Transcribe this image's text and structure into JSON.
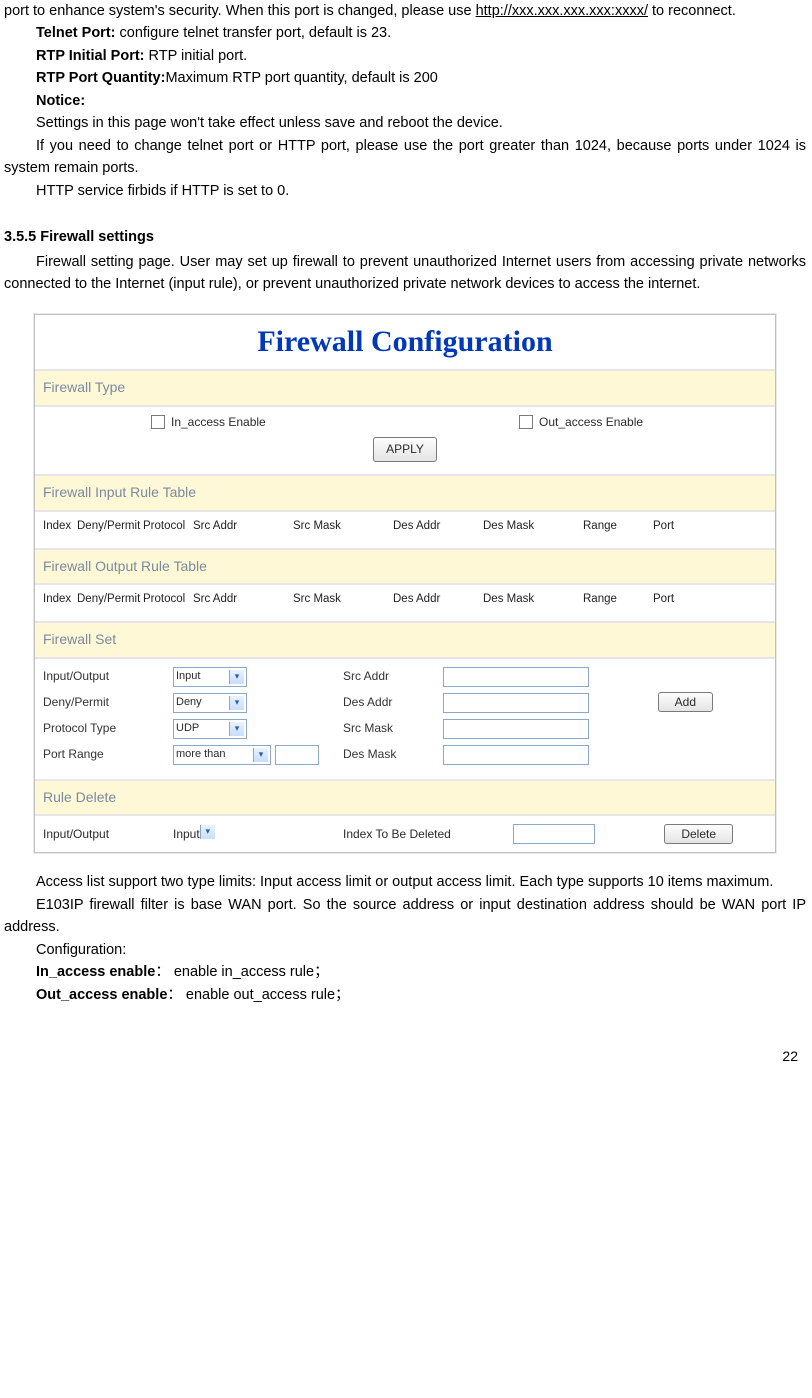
{
  "top": {
    "line1a": "port  to  enhance  system's  security.  When  this  port  is  changed,  please  use ",
    "url": "http://xxx.xxx.xxx.xxx:xxxx/",
    "line1b": " to reconnect.",
    "telnet_label": "Telnet Port:",
    "telnet_text": "    configure telnet transfer port, default is 23.",
    "rtp_init_label": "RTP Initial Port: ",
    "rtp_init_text": "RTP initial port.",
    "rtp_qty_label": "RTP Port Quantity:",
    "rtp_qty_text": "Maximum RTP port quantity, default is 200",
    "notice_label": "Notice:",
    "notice_line1": "Settings in this page won't take effect unless save and reboot the device.",
    "notice_line2": "If you need to change telnet port or HTTP port, please use the port greater than 1024, because ports under 1024 is system remain ports.",
    "notice_line3": "HTTP service firbids if HTTP is set to 0."
  },
  "section": {
    "num_title": "3.5.5 Firewall settings",
    "para": "Firewall setting page. User may set up firewall to prevent unauthorized Internet users from accessing private networks connected to the Internet (input rule), or prevent unauthorized private network devices to access the internet."
  },
  "ss": {
    "title": "Firewall Configuration",
    "ft_head": "Firewall Type",
    "in_access": "In_access Enable",
    "out_access": "Out_access Enable",
    "apply": "APPLY",
    "in_rule_head": "Firewall Input Rule Table",
    "out_rule_head": "Firewall Output Rule Table",
    "cols": {
      "idx": "Index",
      "dp": "Deny/Permit",
      "proto": "Protocol",
      "src": "Src Addr",
      "smask": "Src Mask",
      "des": "Des Addr",
      "dmask": "Des Mask",
      "range": "Range",
      "port": "Port"
    },
    "fs_head": "Firewall Set",
    "fs": {
      "io_lbl": "Input/Output",
      "io_val": "Input",
      "dp_lbl": "Deny/Permit",
      "dp_val": "Deny",
      "proto_lbl": "Protocol Type",
      "proto_val": "UDP",
      "port_lbl": "Port Range",
      "port_val": "more than",
      "src_lbl": "Src Addr",
      "des_lbl": "Des Addr",
      "smask_lbl": "Src Mask",
      "dmask_lbl": "Des Mask",
      "add_btn": "Add"
    },
    "rd_head": "Rule Delete",
    "rd": {
      "io_lbl": "Input/Output",
      "io_val": "Input",
      "idx_lbl": "Index To Be Deleted",
      "del_btn": "Delete"
    }
  },
  "after": {
    "line1": "Access list support two type limits: Input access limit or output access limit. Each type supports 10 items maximum.",
    "line2": "E103IP  firewall  filter  is  base  WAN  port.  So  the  source  address  or  input destination address should be WAN port IP address.",
    "cfg": "Configuration:",
    "in_lbl": "In_access enable",
    "in_txt": "： enable in_access rule；",
    "out_lbl": "Out_access enable",
    "out_txt": "： enable out_access rule；"
  },
  "page_number": "22"
}
